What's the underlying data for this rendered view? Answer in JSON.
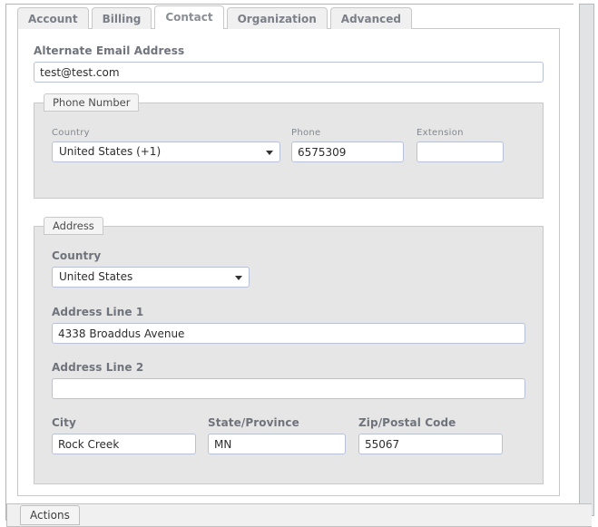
{
  "tabs": [
    {
      "label": "Account",
      "active": false
    },
    {
      "label": "Billing",
      "active": false
    },
    {
      "label": "Contact",
      "active": true
    },
    {
      "label": "Organization",
      "active": false
    },
    {
      "label": "Advanced",
      "active": false
    }
  ],
  "form": {
    "alternate_email": {
      "label": "Alternate Email Address",
      "value": "test@test.com",
      "placeholder": ""
    },
    "phone_section": {
      "legend": "Phone Number",
      "country": {
        "label": "Country",
        "value": "United States (+1)"
      },
      "phone": {
        "label": "Phone",
        "value": "6575309",
        "placeholder": ""
      },
      "extension": {
        "label": "Extension",
        "value": "",
        "placeholder": ""
      }
    },
    "address_section": {
      "legend": "Address",
      "country": {
        "label": "Country",
        "value": "United States"
      },
      "line1": {
        "label": "Address Line 1",
        "value": "4338 Broaddus Avenue",
        "placeholder": ""
      },
      "line2": {
        "label": "Address Line 2",
        "value": "",
        "placeholder": ""
      },
      "city": {
        "label": "City",
        "value": "Rock Creek",
        "placeholder": ""
      },
      "state": {
        "label": "State/Province",
        "value": "MN",
        "placeholder": ""
      },
      "zip": {
        "label": "Zip/Postal Code",
        "value": "55067",
        "placeholder": ""
      }
    }
  },
  "actions": {
    "legend": "Actions"
  },
  "colors": {
    "input_border": "#b9c0da",
    "fieldset_bg": "#e6e6e6",
    "fieldset_border": "#c9c9c9",
    "label_text": "#6f737b",
    "tab_text": "#7b7f87",
    "panel_border": "#c8c8c8"
  }
}
